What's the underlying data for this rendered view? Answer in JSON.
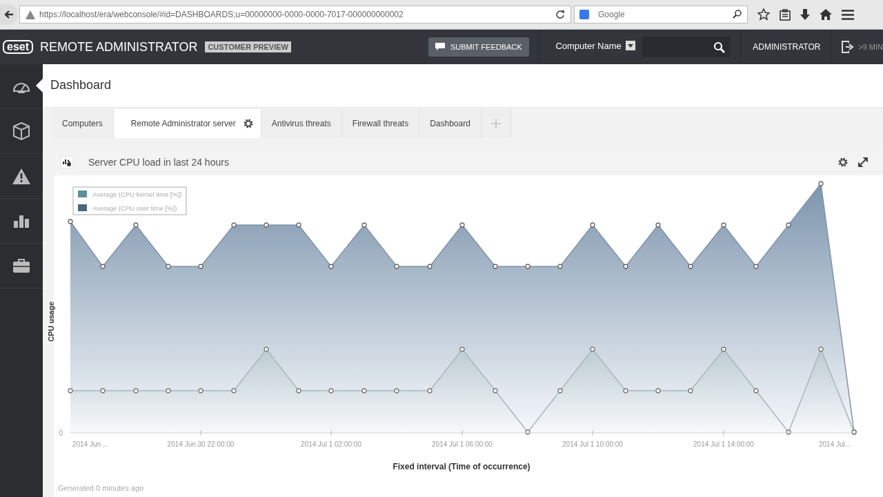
{
  "browser": {
    "url": "https://localhost/era/webconsole/#id=DASHBOARDS;u=00000000-0000-0000-7017-000000000002",
    "search": {
      "placeholder": "Google"
    }
  },
  "header": {
    "logo": "eset",
    "title": "REMOTE ADMINISTRATOR",
    "badge": "CUSTOMER PREVIEW",
    "feedback": "SUBMIT FEEDBACK",
    "filter": "Computer Name",
    "user": "ADMINISTRATOR",
    "session": ">9 MIN"
  },
  "sidebar": {
    "items": [
      {
        "kind": "dashboard",
        "selected": true
      },
      {
        "kind": "box",
        "selected": false
      },
      {
        "kind": "alert",
        "selected": false
      },
      {
        "kind": "reports",
        "selected": false
      },
      {
        "kind": "tools",
        "selected": false
      }
    ]
  },
  "page": {
    "title": "Dashboard"
  },
  "tabs": [
    {
      "label": "Computers",
      "selected": false,
      "settings": false
    },
    {
      "label": "Remote Administrator server",
      "selected": true,
      "settings": true
    },
    {
      "label": "Antivirus threats",
      "selected": false,
      "settings": false
    },
    {
      "label": "Firewall threats",
      "selected": false,
      "settings": false
    },
    {
      "label": "Dashboard",
      "selected": false,
      "settings": false
    }
  ],
  "panel": {
    "title": "Server CPU load in last 24 hours",
    "legend": [
      {
        "label": "Average (CPU kernel time [%])",
        "color": "#5f8f9a"
      },
      {
        "label": "Average (CPU user time [%])",
        "color": "#4d6580"
      }
    ],
    "ylabel": "CPU usage",
    "ytick": "0",
    "xlabels": [
      "2014 Jun ...",
      "2014 Jun 30 22:00:00",
      "2014 Jul 1 02:00:00",
      "2014 Jul 1 06:00:00",
      "2014 Jul 1 10:00:00",
      "2014 Jul 1 14:00:00",
      "2014 Jul..."
    ],
    "xlabel": "Fixed interval (Time of occurrence)",
    "footer": "Generated 0 minutes ago"
  }
}
